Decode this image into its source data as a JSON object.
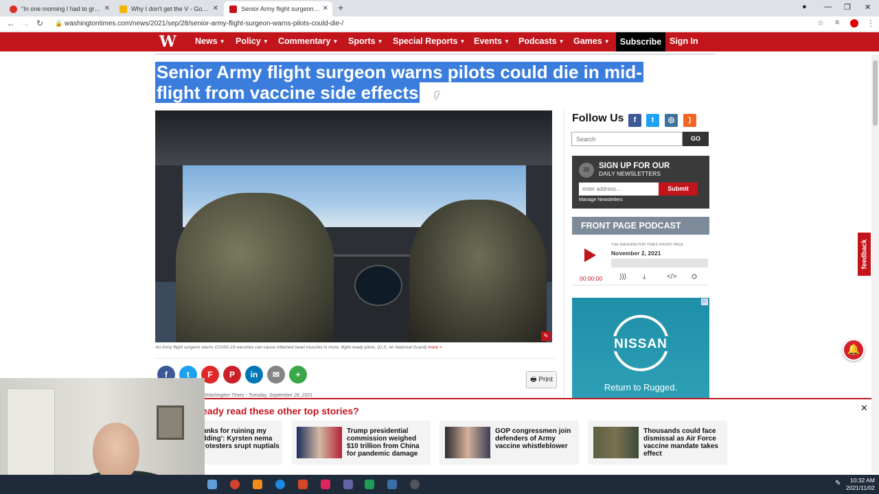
{
  "browser": {
    "tabs": [
      {
        "title": "\"In one morning I had to ground",
        "favicon_color": "#d93025"
      },
      {
        "title": "Why I don't get the V - Google S",
        "favicon_color": "#f4b400"
      },
      {
        "title": "Senior Army flight surgeon warns",
        "favicon_color": "#c2141b"
      }
    ],
    "url": "washingtontimes.com/news/2021/sep/28/senior-army-flight-surgeon-warns-pilots-could-die-/"
  },
  "site": {
    "logo": "W",
    "nav": [
      "News",
      "Policy",
      "Commentary",
      "Sports",
      "Special Reports",
      "Events",
      "Podcasts",
      "Games"
    ],
    "subscribe": "Subscribe",
    "signin": "Sign In",
    "accent": "#c2141b"
  },
  "article": {
    "headline_line1": "Senior Army flight surgeon warns pilots could die in mid-",
    "headline_line2": "flight from vaccine side effects",
    "caption": "An Army flight surgeon warns COVID-19 vaccines can cause inflamed heart muscles in more, flight-ready pilots. (U.S. Air National Guard)",
    "caption_more": "more >",
    "print_label": "Print",
    "byline": "Washington Times - Tuesday, September 28, 2021"
  },
  "share": [
    {
      "icon": "facebook-icon",
      "glyph": "f",
      "color": "#3b5998"
    },
    {
      "icon": "twitter-icon",
      "glyph": "t",
      "color": "#1da1f2"
    },
    {
      "icon": "flipboard-icon",
      "glyph": "F",
      "color": "#e12828"
    },
    {
      "icon": "pinterest-icon",
      "glyph": "P",
      "color": "#cb2027"
    },
    {
      "icon": "linkedin-icon",
      "glyph": "in",
      "color": "#0077b5"
    },
    {
      "icon": "email-icon",
      "glyph": "✉",
      "color": "#848484"
    },
    {
      "icon": "more-share-icon",
      "glyph": "+",
      "color": "#3aa748"
    }
  ],
  "sidebar": {
    "follow_title": "Follow Us",
    "social": [
      {
        "icon": "facebook-icon",
        "glyph": "f",
        "color": "#3b5998"
      },
      {
        "icon": "twitter-icon",
        "glyph": "t",
        "color": "#1da1f2"
      },
      {
        "icon": "instagram-icon",
        "glyph": "◎",
        "color": "#3f729b"
      },
      {
        "icon": "rss-icon",
        "glyph": ")",
        "color": "#f26522"
      }
    ],
    "search_placeholder": "Search",
    "go_label": "GO",
    "newsletter": {
      "title": "SIGN UP FOR OUR",
      "subtitle": "DAILY NEWSLETTERS",
      "placeholder": "enter address...",
      "submit": "Submit",
      "manage": "Manage Newsletters"
    },
    "podcast": {
      "header": "FRONT PAGE PODCAST",
      "series": "THE WASHINGTON TIMES FRONT PAGE",
      "date": "November 2, 2021",
      "time": "00:00:00"
    },
    "ad": {
      "brand": "NISSAN",
      "tagline": "Return to Rugged."
    }
  },
  "feedback_label": "feedback",
  "recommendations": {
    "title": "eady read these other top stories?",
    "items": [
      {
        "text": "hanks for ruining my edding': Kyrsten nema protesters srupt nuptials"
      },
      {
        "text": "Trump presidential commission weighed $10 trillion from China for pandemic damage"
      },
      {
        "text": "GOP congressmen join defenders of Army vaccine whistleblower"
      },
      {
        "text": "Thousands could face dismissal as Air Force vaccine mandate takes effect"
      }
    ]
  },
  "taskbar": {
    "time": "10:32 AM",
    "date": "2021/11/02"
  }
}
